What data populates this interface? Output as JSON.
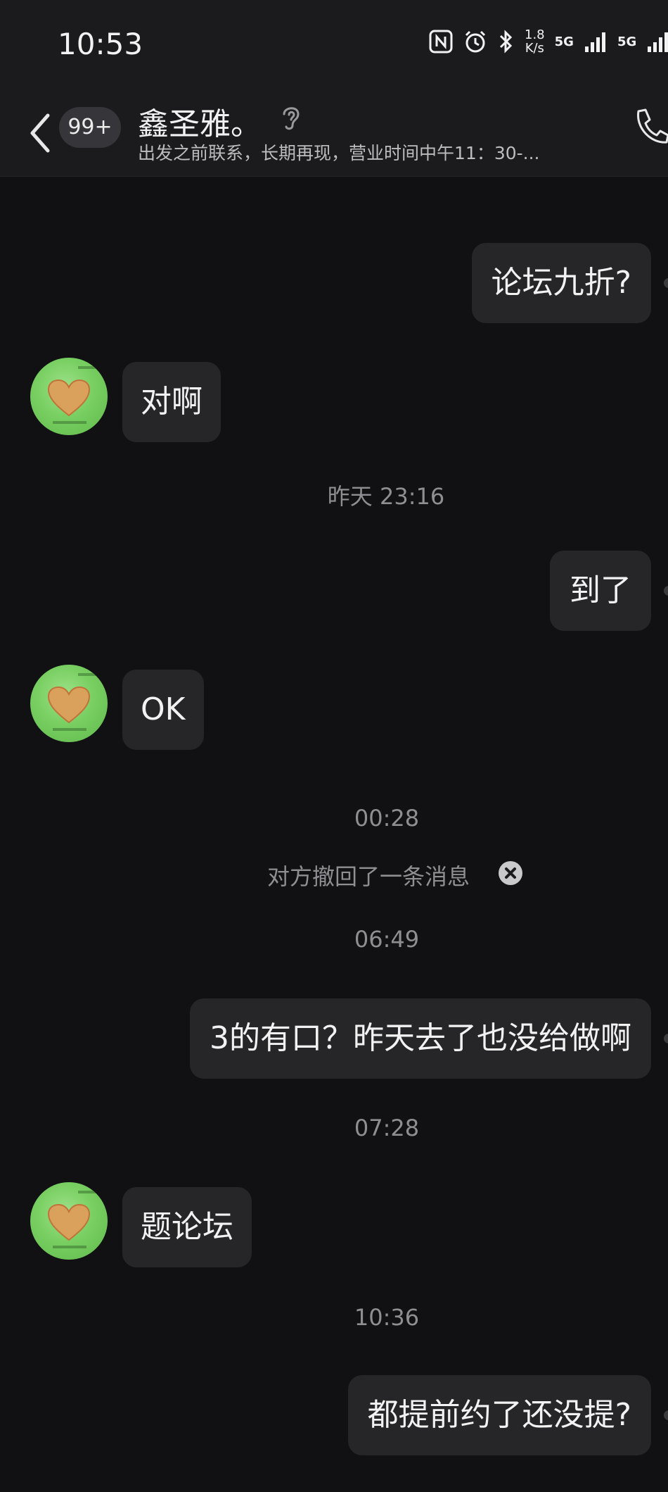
{
  "status_bar": {
    "time": "10:53",
    "speed_value": "1.8",
    "speed_unit": "K/s",
    "network_1": "5G",
    "network_2": "5G"
  },
  "header": {
    "unread_badge": "99+",
    "contact_name": "鑫圣雅。",
    "subtitle": "出发之前联系，长期再现，营业时间中午11：30-..."
  },
  "messages": [
    {
      "type": "outgoing",
      "text": "论坛九折?"
    },
    {
      "type": "incoming",
      "text": "对啊"
    },
    {
      "type": "timestamp",
      "text": "昨天 23:16"
    },
    {
      "type": "outgoing",
      "text": "到了"
    },
    {
      "type": "incoming",
      "text": "OK"
    },
    {
      "type": "timestamp",
      "text": "00:28"
    },
    {
      "type": "system",
      "text": "对方撤回了一条消息"
    },
    {
      "type": "timestamp",
      "text": "06:49"
    },
    {
      "type": "outgoing",
      "text": "3的有口？昨天去了也没给做啊"
    },
    {
      "type": "timestamp",
      "text": "07:28"
    },
    {
      "type": "incoming",
      "text": "题论坛"
    },
    {
      "type": "timestamp",
      "text": "10:36"
    },
    {
      "type": "outgoing",
      "text": "都提前约了还没提?"
    }
  ],
  "icons": {
    "back": "chevron-left-icon",
    "ear": "ear-icon",
    "phone": "phone-icon",
    "nfc": "nfc-icon",
    "alarm": "alarm-icon",
    "bluetooth": "bluetooth-icon",
    "recall_dismiss": "close-icon"
  },
  "colors": {
    "background": "#111113",
    "bubble": "#262629",
    "avatar_green": "#79cf62"
  }
}
